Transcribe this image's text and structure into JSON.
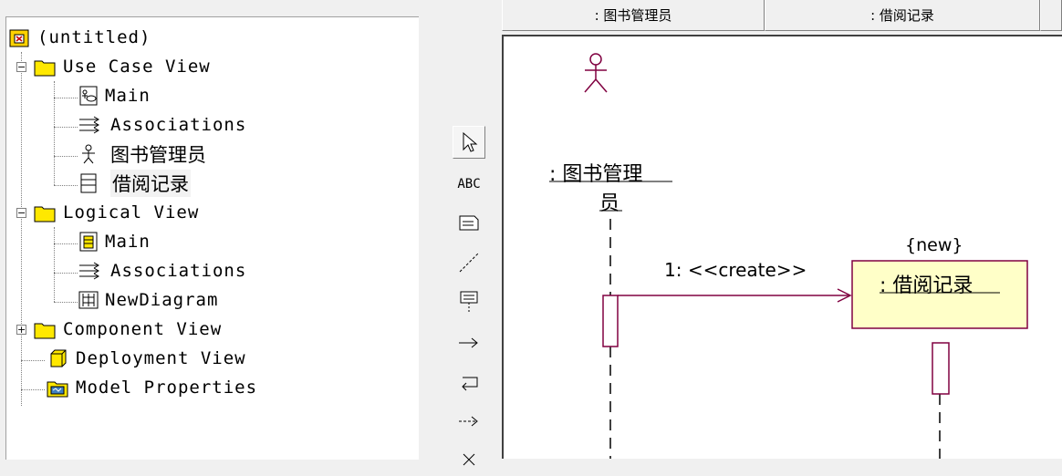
{
  "tree": {
    "root_label": "(untitled)",
    "items": [
      {
        "label": "Use Case View",
        "icon": "folder-icon"
      },
      {
        "label": "Main",
        "icon": "usecase-diagram-icon"
      },
      {
        "label": "Associations",
        "icon": "associations-icon"
      },
      {
        "label": "图书管理员",
        "icon": "actor-icon"
      },
      {
        "label": "借阅记录",
        "icon": "class-icon"
      },
      {
        "label": "Logical View",
        "icon": "folder-icon"
      },
      {
        "label": "Main",
        "icon": "class-diagram-icon"
      },
      {
        "label": "Associations",
        "icon": "associations-icon"
      },
      {
        "label": "NewDiagram",
        "icon": "sequence-diagram-icon"
      },
      {
        "label": "Component View",
        "icon": "folder-icon"
      },
      {
        "label": "Deployment View",
        "icon": "deployment-icon"
      },
      {
        "label": "Model Properties",
        "icon": "model-properties-icon"
      }
    ],
    "expander_minus": "−",
    "expander_plus": "+"
  },
  "toolbox": {
    "text_tool": "ABC"
  },
  "diagram": {
    "tabs": [
      ": 图书管理员",
      ": 借阅记录"
    ],
    "actor_label_line1": ": 图书管理",
    "actor_label_line2": "员",
    "object_label": ": 借阅记录",
    "new_tag": "{new}",
    "message_label": "1: <<create>>"
  },
  "colors": {
    "accent": "#800040",
    "object_fill": "#ffffc8"
  }
}
